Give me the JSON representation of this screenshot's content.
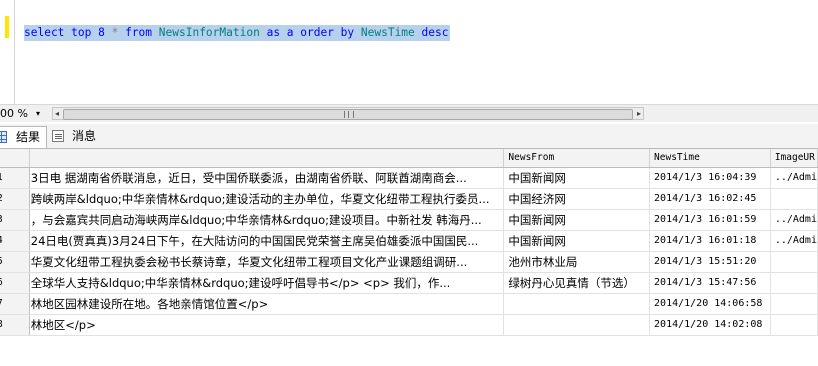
{
  "editor": {
    "sql": {
      "kw1": "select top 8",
      "op": "*",
      "kw2": "from",
      "table": "NewsInforMation",
      "kw3": "as a order by",
      "column": "NewsTime",
      "kw4": "desc"
    }
  },
  "zoom": {
    "value": "00 %",
    "arrow": "▾"
  },
  "tabs": {
    "results": "结果",
    "messages": "消息"
  },
  "grid": {
    "columns": [
      "NewsFrom",
      "NewsTime",
      "ImageUR"
    ],
    "rows": [
      {
        "rn": "1",
        "content": "3日电 据湖南省侨联消息，近日，受中国侨联委派，由湖南省侨联、阿联酋湖南商会...",
        "from": " 中国新闻网",
        "time": "2014/1/3 16:04:39",
        "image": "../Admi"
      },
      {
        "rn": "2",
        "content": "跨峡两岸&ldquo;中华亲情林&rdquo;建设活动的主办单位，华夏文化纽带工程执行委员...",
        "from": "中国经济网",
        "time": "2014/1/3 16:02:45",
        "image": ""
      },
      {
        "rn": "3",
        "content": "，与会嘉宾共同启动海峡两岸&ldquo;中华亲情林&rdquo;建设项目。中新社发 韩海丹...",
        "from": "中国新闻网",
        "time": "2014/1/3 16:01:59",
        "image": "../Admi"
      },
      {
        "rn": "4",
        "content": "24日电(贾真真)3月24日下午，在大陆访问的中国国民党荣誉主席吴伯雄委派中国国民...",
        "from": "中国新闻网",
        "time": "2014/1/3 16:01:18",
        "image": "../Admi"
      },
      {
        "rn": "5",
        "content": "华夏文化纽带工程执委会秘书长蔡诗章，华夏文化纽带工程项目文化产业课题组调研...",
        "from": "池州市林业局",
        "time": "2014/1/3 15:51:20",
        "image": ""
      },
      {
        "rn": "6",
        "content": "全球华人支持&ldquo;中华亲情林&rdquo;建设呼吁倡导书</p>   <p>   我们，作...",
        "from": "绿树丹心见真情（节选）",
        "time": "2014/1/3 15:47:56",
        "image": ""
      },
      {
        "rn": "7",
        "content": "林地区园林建设所在地。各地亲情馆位置</p>",
        "from": "",
        "time": "2014/1/20 14:06:58",
        "image": ""
      },
      {
        "rn": "8",
        "content": "林地区</p>",
        "from": "",
        "time": "2014/1/20 14:02:08",
        "image": ""
      }
    ]
  }
}
